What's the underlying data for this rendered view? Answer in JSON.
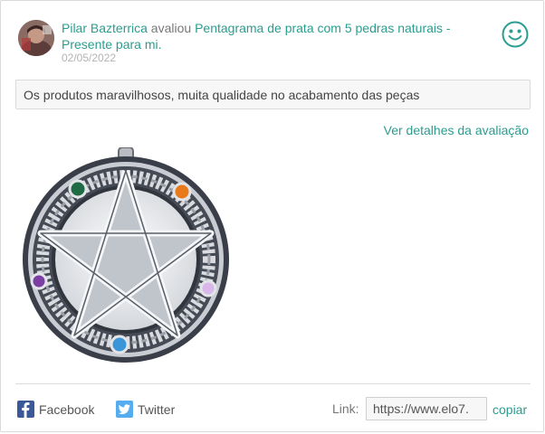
{
  "review": {
    "reviewer_name": "Pilar Bazterrica",
    "action": " avaliou ",
    "product_name": "Pentagrama de prata com 5 pedras naturais - Presente para mi.",
    "date": "02/05/2022",
    "comment": "Os produtos maravilhosos, muita qualidade no acabamento das peças",
    "details_link": "Ver detalhes da avaliação",
    "sentiment_icon": "smiley-face-icon"
  },
  "share": {
    "facebook_label": "Facebook",
    "twitter_label": "Twitter",
    "link_label": "Link:",
    "link_value": "https://www.elo7.",
    "copy_label": "copiar"
  },
  "colors": {
    "accent": "#2a9d8f",
    "facebook": "#3b5998",
    "twitter": "#55acee",
    "date": "#b3b3b3"
  }
}
